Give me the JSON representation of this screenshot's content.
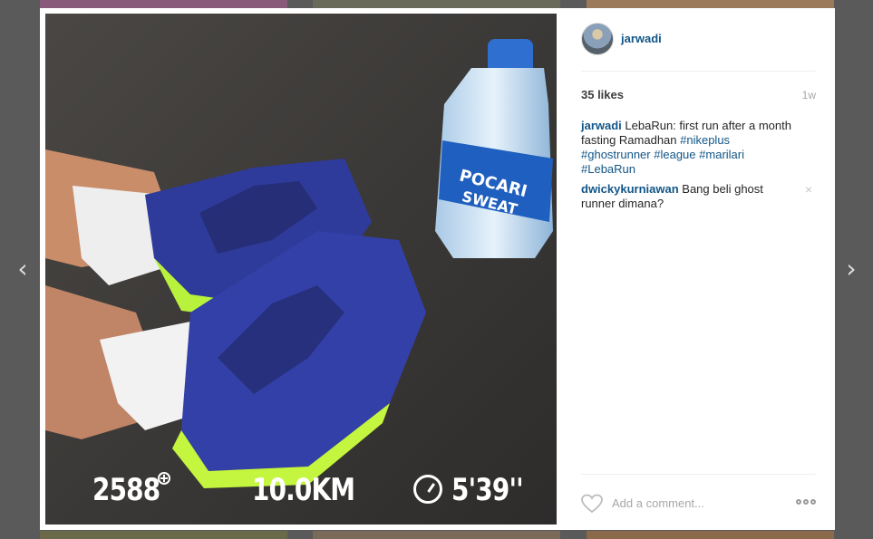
{
  "post": {
    "username": "jarwadi",
    "likes": "35 likes",
    "time_ago": "1w",
    "photo_overlay": {
      "steps": "2588",
      "distance": "10.0KM",
      "pace": "5'39''"
    }
  },
  "comments": [
    {
      "author": "jarwadi",
      "text": " LebaRun: first run after a month fasting Ramadhan ",
      "tags": [
        "#nikeplus",
        "#ghostrunner",
        "#league",
        "#marilari",
        "#LebaRun"
      ]
    },
    {
      "author": "dwickykurniawan",
      "text": " Bang beli ghost runner dimana?",
      "tags": [],
      "delete_icon": "×"
    }
  ],
  "add_comment": {
    "placeholder": "Add a comment..."
  },
  "nav": {
    "prev_glyph": "‹",
    "next_glyph": "›"
  },
  "icons": {
    "heart": "heart-icon",
    "more": "more-options-icon",
    "plus": "plus-icon",
    "timer": "timer-icon"
  },
  "colors": {
    "link": "#125688",
    "text": "#262626",
    "muted": "#a5a7aa"
  }
}
